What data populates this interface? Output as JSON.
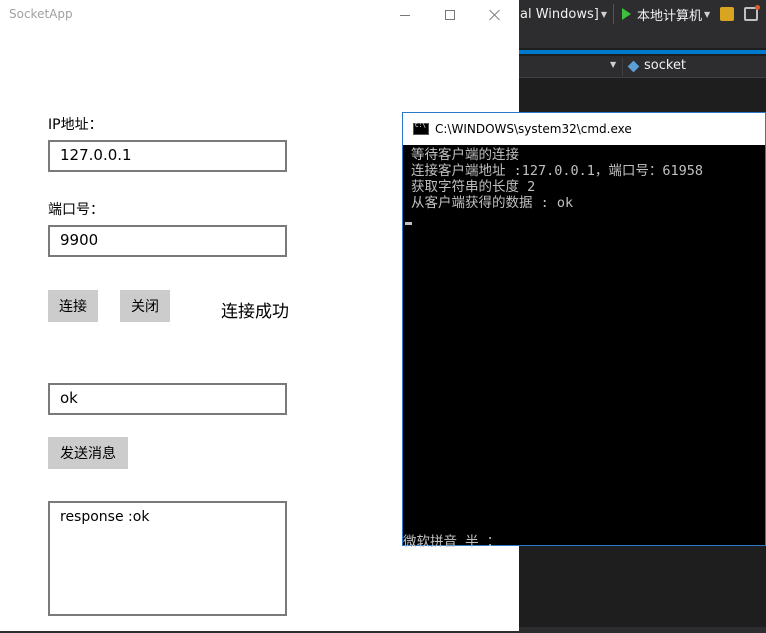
{
  "ide": {
    "platform_label": "al Windows]",
    "run_label": "本地计算机",
    "nav_label": "socket"
  },
  "app": {
    "title": "SocketApp",
    "ip_label": "IP地址：",
    "ip_value": "127.0.0.1",
    "port_label": "端口号：",
    "port_value": "9900",
    "connect_button": "连接",
    "close_button": "关闭",
    "status_text": "连接成功",
    "message_value": "ok",
    "send_button": "发送消息",
    "response_text": "response :ok"
  },
  "cmd": {
    "title": "C:\\WINDOWS\\system32\\cmd.exe",
    "lines": [
      "等待客户端的连接",
      "连接客户端地址 :127.0.0.1，端口号：61958",
      "获取字符串的长度 2",
      "从客户端获得的数据 : ok"
    ],
    "ime_status": "微软拼音 半 ："
  }
}
